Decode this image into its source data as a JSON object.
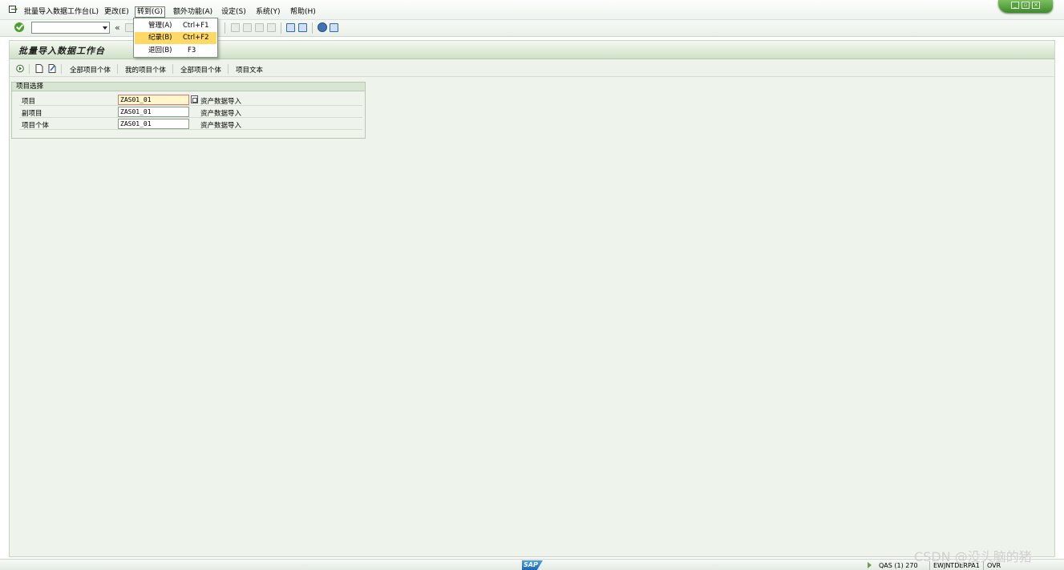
{
  "menubar": {
    "items": [
      "批量导入数据工作台(L)",
      "更改(E)",
      "转到(G)",
      "额外功能(A)",
      "设定(S)",
      "系统(Y)",
      "帮助(H)"
    ]
  },
  "goto_menu": {
    "items": [
      {
        "label": "管理(A)",
        "shortcut": "Ctrl+F1"
      },
      {
        "label": "纪录(B)",
        "shortcut": "Ctrl+F2"
      },
      {
        "label": "退回(B)",
        "shortcut": "F3"
      }
    ]
  },
  "toolbar": {
    "command_field_value": "",
    "collapse_glyph": "«"
  },
  "screen": {
    "title": "批量导入数据工作台"
  },
  "app_toolbar": {
    "buttons": [
      "全部项目个体",
      "我的项目个体",
      "全部项目个体",
      "项目文本"
    ]
  },
  "project_selection": {
    "title": "项目选择",
    "rows": [
      {
        "label": "项目",
        "value": "ZAS01_01",
        "description": "资产数据导入"
      },
      {
        "label": "副项目",
        "value": "ZAS01_01",
        "description": "资产数据导入"
      },
      {
        "label": "项目个体",
        "value": "ZAS01_01",
        "description": "资产数据导入"
      }
    ]
  },
  "statusbar": {
    "logo_text": "SAP",
    "system": "QAS (1) 270",
    "server": "EWJNTDERPA1",
    "mode": "OVR"
  },
  "watermark": "CSDN @没头脑的猪",
  "colors": {
    "highlight": "#ffd966",
    "frame_bg": "#eef4eb",
    "accent_green": "#4aa02c"
  }
}
